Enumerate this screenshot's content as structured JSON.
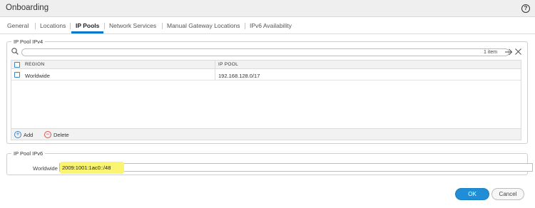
{
  "window": {
    "title": "Onboarding",
    "help_glyph": "?"
  },
  "tabs": [
    {
      "label": "General"
    },
    {
      "label": "Locations"
    },
    {
      "label": "IP Pools"
    },
    {
      "label": "Network Services"
    },
    {
      "label": "Manual Gateway Locations"
    },
    {
      "label": "IPv6 Availability"
    }
  ],
  "active_tab": "IP Pools",
  "ipv4": {
    "legend": "IP Pool IPv4",
    "search": {
      "value": "",
      "placeholder": ""
    },
    "item_count": "1 item",
    "columns": [
      "REGION",
      "IP POOL"
    ],
    "rows": [
      {
        "region": "Worldwide",
        "ip_pool": "192.168.128.0/17"
      }
    ],
    "add_label": "Add",
    "delete_label": "Delete"
  },
  "ipv6": {
    "legend": "IP Pool IPv6",
    "field_label": "Worldwide",
    "field_value": "2009:1001:1ac0::/48"
  },
  "buttons": {
    "ok": "OK",
    "cancel": "Cancel"
  },
  "colors": {
    "accent": "#1f8ed6",
    "highlight": "#f9f573",
    "delete": "#d9534f"
  }
}
